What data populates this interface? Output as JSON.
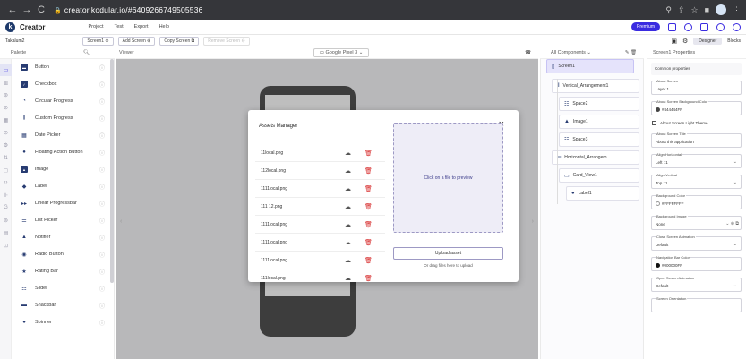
{
  "browser": {
    "url": "creator.kodular.io/#6409266749505536"
  },
  "app": {
    "brand": "Creator",
    "menu": [
      "Project",
      "Test",
      "Export",
      "Help"
    ],
    "premium": "Premium"
  },
  "toolbar": {
    "project": "Takalum2",
    "screen": "Screen1",
    "add_screen": "Add Screen",
    "copy_screen": "Copy Screen",
    "remove_screen": "Remove Screen",
    "designer": "Designer",
    "blocks": "Blocks"
  },
  "headers": {
    "palette": "Palette",
    "viewer": "Viewer",
    "device": "Google Pixel 3",
    "components": "All Components",
    "properties": "Screen1 Properties"
  },
  "palette": {
    "items": [
      {
        "label": "Button",
        "icon": "button-icon"
      },
      {
        "label": "Checkbox",
        "icon": "checkbox-icon"
      },
      {
        "label": "Circular Progress",
        "icon": "circular-progress-icon"
      },
      {
        "label": "Custom Progress",
        "icon": "custom-progress-icon"
      },
      {
        "label": "Date Picker",
        "icon": "date-picker-icon"
      },
      {
        "label": "Floating Action Button",
        "icon": "fab-icon"
      },
      {
        "label": "Image",
        "icon": "image-icon"
      },
      {
        "label": "Label",
        "icon": "label-icon"
      },
      {
        "label": "Linear Progressbar",
        "icon": "linear-progress-icon"
      },
      {
        "label": "List Picker",
        "icon": "list-picker-icon"
      },
      {
        "label": "Notifier",
        "icon": "notifier-icon"
      },
      {
        "label": "Radio Button",
        "icon": "radio-button-icon"
      },
      {
        "label": "Rating Bar",
        "icon": "rating-bar-icon"
      },
      {
        "label": "Slider",
        "icon": "slider-icon"
      },
      {
        "label": "Snackbar",
        "icon": "snackbar-icon"
      },
      {
        "label": "Spinner",
        "icon": "spinner-icon"
      }
    ]
  },
  "assets": {
    "title": "Assets Manager",
    "files": [
      "11local.png",
      "112local.png",
      "1111local.png",
      "111 12.png",
      "1111local.png",
      "1111local.png",
      "1111local.png",
      "111local.png"
    ],
    "preview_hint": "Click on a file to preview",
    "upload": "Upload asset",
    "drag_hint": "Or drag files here to upload"
  },
  "components": {
    "items": [
      "Screen1",
      "Vertical_Arrangement1",
      "Space2",
      "Image1",
      "Space3",
      "Horizontal_Arrangem...",
      "Card_View1",
      "Label1"
    ]
  },
  "properties": {
    "common": "Common properties",
    "about_screen_label": "About Screen",
    "about_screen_value": "Layer 1",
    "bg_color_label": "About Screen Background Color",
    "bg_color_value": "#444444FF",
    "light_theme": "About Screen Light Theme",
    "title_label": "About Screen Title",
    "title_value": "About this application",
    "align_h_label": "Align Horizontal",
    "align_h_value": "Left : 1",
    "align_v_label": "Align Vertical",
    "align_v_value": "Top : 1",
    "bgc_label": "Background Color",
    "bgc_value": "#FFFFFFFF",
    "bgi_label": "Background Image",
    "bgi_value": "None",
    "close_anim_label": "Close Screen Animation",
    "close_anim_value": "Default",
    "navbar_label": "Navigation Bar Color",
    "navbar_value": "#000000FF",
    "open_anim_label": "Open Screen Animation",
    "open_anim_value": "Default",
    "orientation_label": "Screen Orientation"
  }
}
